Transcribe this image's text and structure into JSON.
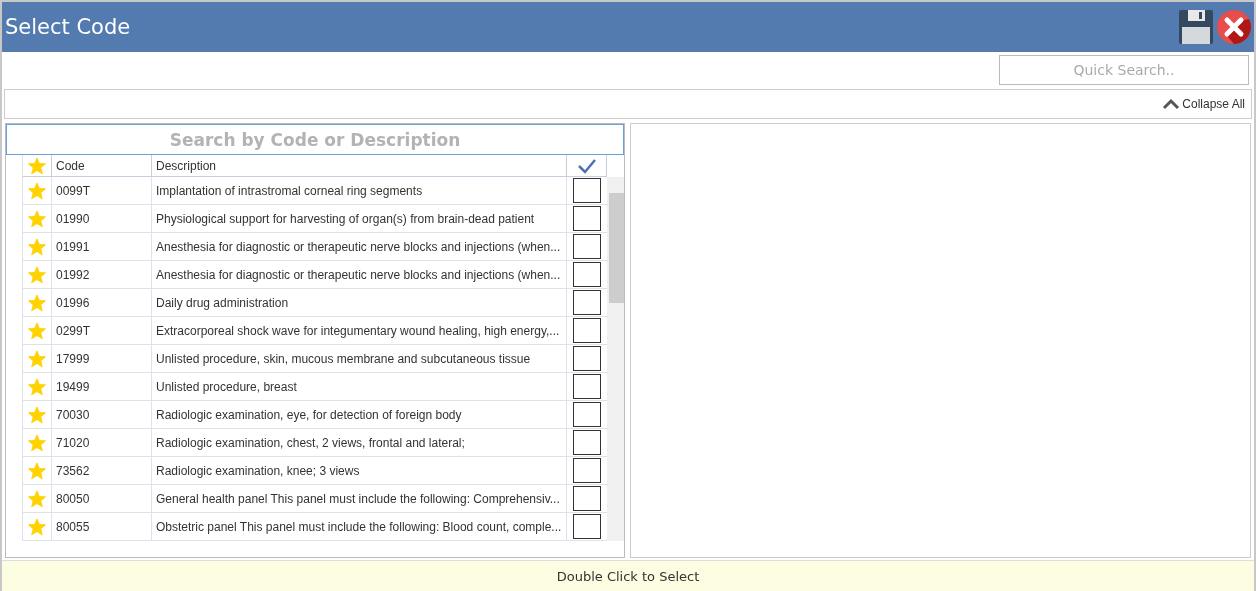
{
  "window": {
    "title": "Select Code"
  },
  "quick_search": {
    "placeholder": "Quick Search.."
  },
  "collapse_all": "Collapse All",
  "code_search": {
    "placeholder": "Search by Code or Description"
  },
  "table": {
    "columns": [
      "Code",
      "Description"
    ],
    "rows": [
      {
        "code": "0099T",
        "description": "Implantation of intrastromal corneal ring segments",
        "starred": true,
        "checked": false
      },
      {
        "code": "01990",
        "description": "Physiological support for harvesting of organ(s) from brain-dead patient",
        "starred": true,
        "checked": false
      },
      {
        "code": "01991",
        "description": "Anesthesia for diagnostic or therapeutic nerve blocks and injections (when...",
        "starred": true,
        "checked": false
      },
      {
        "code": "01992",
        "description": "Anesthesia for diagnostic or therapeutic nerve blocks and injections (when...",
        "starred": true,
        "checked": false
      },
      {
        "code": "01996",
        "description": "Daily drug administration",
        "starred": true,
        "checked": false
      },
      {
        "code": "0299T",
        "description": "Extracorporeal shock wave for integumentary wound healing, high energy,...",
        "starred": true,
        "checked": false
      },
      {
        "code": "17999",
        "description": "Unlisted procedure, skin, mucous membrane and subcutaneous tissue",
        "starred": true,
        "checked": false
      },
      {
        "code": "19499",
        "description": "Unlisted procedure, breast",
        "starred": true,
        "checked": false
      },
      {
        "code": "70030",
        "description": "Radiologic examination, eye, for detection of foreign body",
        "starred": true,
        "checked": false
      },
      {
        "code": "71020",
        "description": "Radiologic examination, chest, 2 views, frontal and lateral;",
        "starred": true,
        "checked": false
      },
      {
        "code": "73562",
        "description": "Radiologic examination, knee; 3 views",
        "starred": true,
        "checked": false
      },
      {
        "code": "80050",
        "description": "General health panel This panel must include the following: Comprehensiv...",
        "starred": true,
        "checked": false
      },
      {
        "code": "80055",
        "description": "Obstetric panel This panel must include the following: Blood count, comple...",
        "starred": true,
        "checked": false
      }
    ]
  },
  "status_bar": "Double Click to Select"
}
